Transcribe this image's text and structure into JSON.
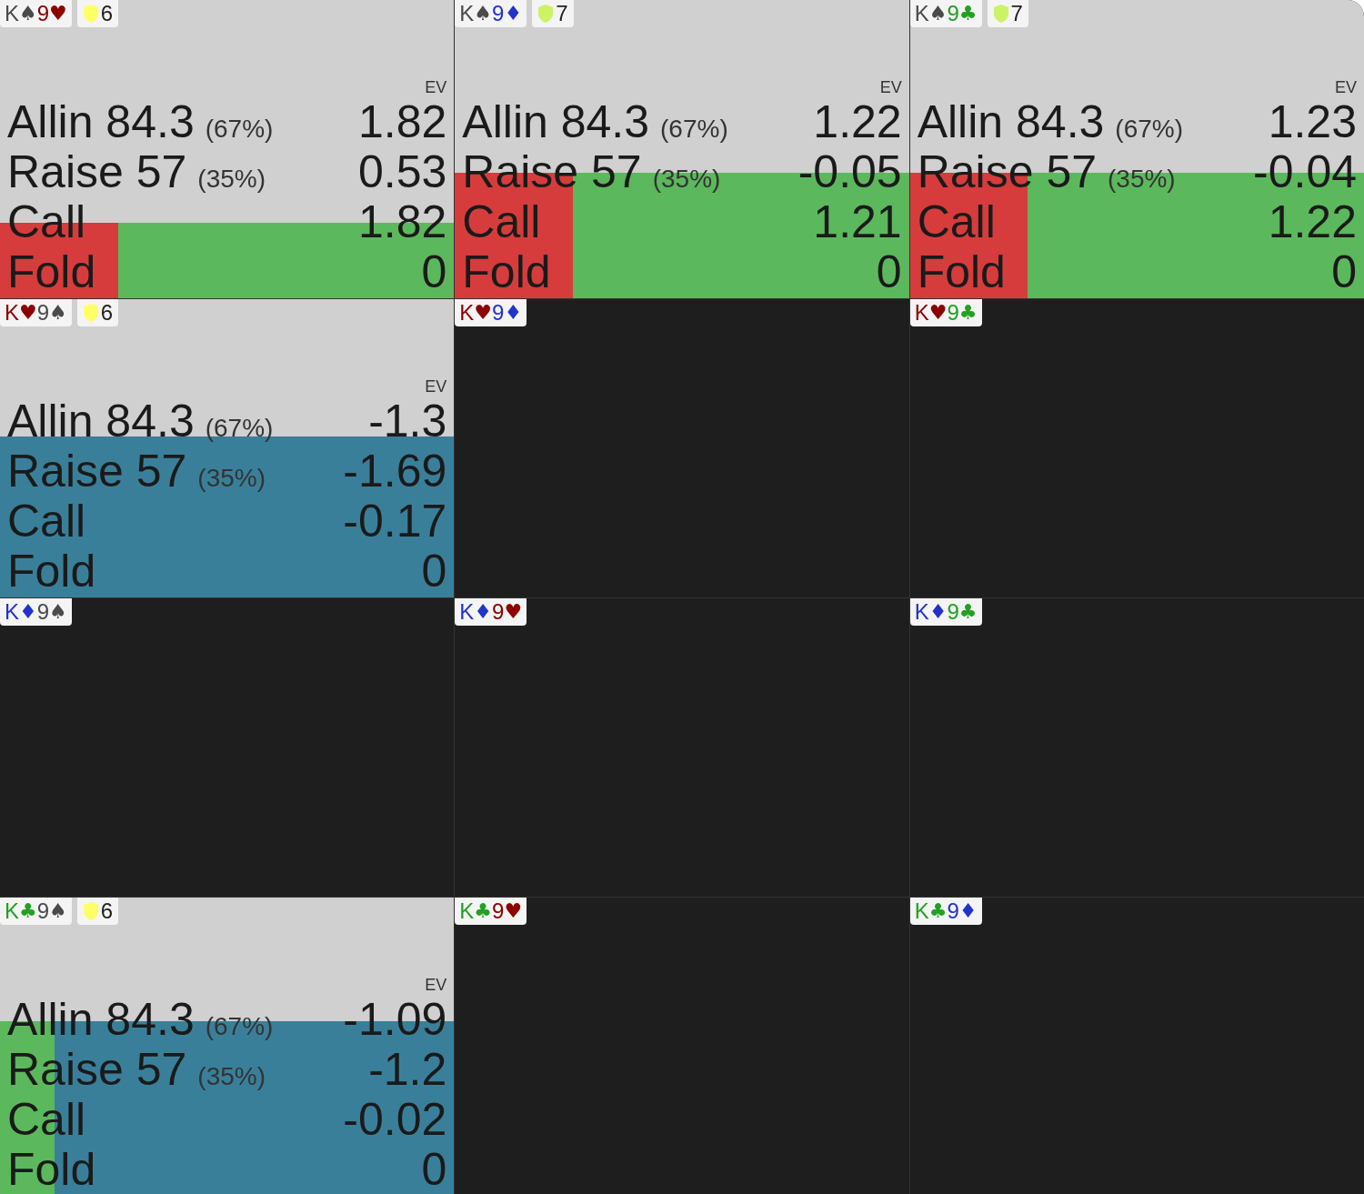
{
  "cells": [
    {
      "cards": [
        {
          "rank": "K",
          "suit": "♠",
          "color": "#4a4a4a"
        },
        {
          "rank": "9",
          "suit": "♥",
          "color": "#8b0000"
        }
      ],
      "badge": {
        "value": "6",
        "color": "#ffff66"
      },
      "ev_label": "EV",
      "strategy": {
        "segments": [
          {
            "color": "#d63c3c",
            "level": 0.26
          },
          {
            "color": "#5cb85c"
          }
        ]
      },
      "actions": [
        {
          "name": "Allin 84.3",
          "pct": "(67%)",
          "ev": "1.82"
        },
        {
          "name": "Raise 57",
          "pct": "(35%)",
          "ev": "0.53"
        },
        {
          "name": "Call",
          "ev": "1.82"
        },
        {
          "name": "Fold",
          "ev": "0"
        }
      ]
    },
    {
      "cards": [
        {
          "rank": "K",
          "suit": "♠",
          "color": "#4a4a4a"
        },
        {
          "rank": "9",
          "suit": "♦",
          "color": "#2233cc"
        }
      ],
      "badge": {
        "value": "7",
        "color": "#ccf266"
      },
      "ev_label": "EV",
      "strategy": {
        "segments": [
          {
            "color": "#d63c3c",
            "level": 0.26
          },
          {
            "color": "#5cb85c"
          }
        ]
      },
      "actions": [
        {
          "name": "Allin 84.3",
          "pct": "(67%)",
          "ev": "1.22"
        },
        {
          "name": "Raise 57",
          "pct": "(35%)",
          "ev": "-0.05"
        },
        {
          "name": "Call",
          "ev": "1.21"
        },
        {
          "name": "Fold",
          "ev": "0"
        }
      ]
    },
    {
      "cards": [
        {
          "rank": "K",
          "suit": "♠",
          "color": "#4a4a4a"
        },
        {
          "rank": "9",
          "suit": "♣",
          "color": "#22a022"
        }
      ],
      "badge": {
        "value": "7",
        "color": "#ccf266"
      },
      "ev_label": "EV",
      "strategy": {
        "segments": [
          {
            "color": "#d63c3c",
            "level": 0.26
          },
          {
            "color": "#5cb85c"
          }
        ]
      },
      "actions": [
        {
          "name": "Allin 84.3",
          "pct": "(67%)",
          "ev": "1.23"
        },
        {
          "name": "Raise 57",
          "pct": "(35%)",
          "ev": "-0.04"
        },
        {
          "name": "Call",
          "ev": "1.22"
        },
        {
          "name": "Fold",
          "ev": "0"
        }
      ]
    },
    {
      "cards": [
        {
          "rank": "K",
          "suit": "♥",
          "color": "#8b0000"
        },
        {
          "rank": "9",
          "suit": "♠",
          "color": "#4a4a4a"
        }
      ],
      "badge": {
        "value": "6",
        "color": "#ffff66"
      },
      "ev_label": "EV",
      "strategy": {
        "segments": [
          {
            "color": "#3a7f9a"
          }
        ]
      },
      "actions": [
        {
          "name": "Allin 84.3",
          "pct": "(67%)",
          "ev": "-1.3"
        },
        {
          "name": "Raise 57",
          "pct": "(35%)",
          "ev": "-1.69"
        },
        {
          "name": "Call",
          "ev": "-0.17"
        },
        {
          "name": "Fold",
          "ev": "0"
        }
      ]
    },
    {
      "cards": [
        {
          "rank": "K",
          "suit": "♥",
          "color": "#8b0000"
        },
        {
          "rank": "9",
          "suit": "♦",
          "color": "#2233cc"
        }
      ]
    },
    {
      "cards": [
        {
          "rank": "K",
          "suit": "♥",
          "color": "#8b0000"
        },
        {
          "rank": "9",
          "suit": "♣",
          "color": "#22a022"
        }
      ]
    },
    {
      "cards": [
        {
          "rank": "K",
          "suit": "♦",
          "color": "#2233cc"
        },
        {
          "rank": "9",
          "suit": "♠",
          "color": "#4a4a4a"
        }
      ]
    },
    {
      "cards": [
        {
          "rank": "K",
          "suit": "♦",
          "color": "#2233cc"
        },
        {
          "rank": "9",
          "suit": "♥",
          "color": "#8b0000"
        }
      ]
    },
    {
      "cards": [
        {
          "rank": "K",
          "suit": "♦",
          "color": "#2233cc"
        },
        {
          "rank": "9",
          "suit": "♣",
          "color": "#22a022"
        }
      ]
    },
    {
      "cards": [
        {
          "rank": "K",
          "suit": "♣",
          "color": "#22a022"
        },
        {
          "rank": "9",
          "suit": "♠",
          "color": "#4a4a4a"
        }
      ],
      "badge": {
        "value": "6",
        "color": "#ffff66"
      },
      "ev_label": "EV",
      "strategy": {
        "segments": [
          {
            "color": "#5cb85c",
            "level": 0.12
          },
          {
            "color": "#3a7f9a"
          }
        ]
      },
      "actions": [
        {
          "name": "Allin 84.3",
          "pct": "(67%)",
          "ev": "-1.09"
        },
        {
          "name": "Raise 57",
          "pct": "(35%)",
          "ev": "-1.2"
        },
        {
          "name": "Call",
          "ev": "-0.02"
        },
        {
          "name": "Fold",
          "ev": "0"
        }
      ]
    },
    {
      "cards": [
        {
          "rank": "K",
          "suit": "♣",
          "color": "#22a022"
        },
        {
          "rank": "9",
          "suit": "♥",
          "color": "#8b0000"
        }
      ]
    },
    {
      "cards": [
        {
          "rank": "K",
          "suit": "♣",
          "color": "#22a022"
        },
        {
          "rank": "9",
          "suit": "♦",
          "color": "#2233cc"
        }
      ]
    }
  ]
}
